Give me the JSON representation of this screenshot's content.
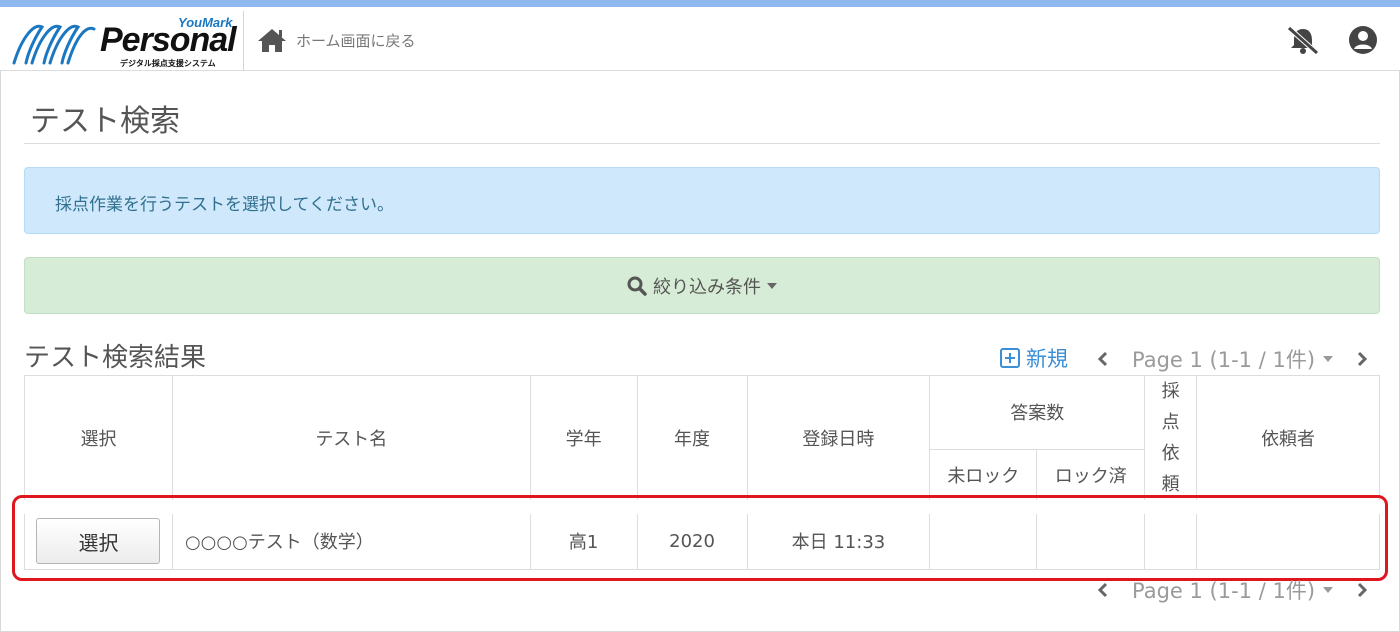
{
  "app": {
    "logo_brand": "YouMark",
    "logo_name": "Personal",
    "logo_subtitle": "デジタル採点支援システム",
    "home_link": "ホーム画面に戻る",
    "icons": {
      "home": "home-icon",
      "notifications": "bell-slash-icon",
      "account": "user-circle-icon"
    }
  },
  "page": {
    "title": "テスト検索",
    "info_message": "採点作業を行うテストを選択してください。",
    "filter_label": "絞り込み条件",
    "results_title": "テスト検索結果",
    "new_label": "新規",
    "pager_label": "Page 1 (1-1 / 1件)"
  },
  "table": {
    "headers": {
      "select": "選択",
      "test_name": "テスト名",
      "grade": "学年",
      "year": "年度",
      "registered": "登録日時",
      "answers": "答案数",
      "unlocked": "未ロック",
      "locked": "ロック済",
      "scoring_request": "採点依頼",
      "requester": "依頼者"
    },
    "rows": [
      {
        "select_label": "選択",
        "test_name": "○○○○テスト（数学）",
        "grade": "高1",
        "year": "2020",
        "registered": "本日 11:33",
        "unlocked": "",
        "locked": "",
        "scoring_request": "",
        "requester": ""
      }
    ]
  },
  "colors": {
    "accent_bar": "#8fb8ef",
    "info_bg": "#cfe8fb",
    "filter_bg": "#d6ecd6",
    "link_blue": "#3b8ed8",
    "highlight_red": "#e0161e"
  }
}
